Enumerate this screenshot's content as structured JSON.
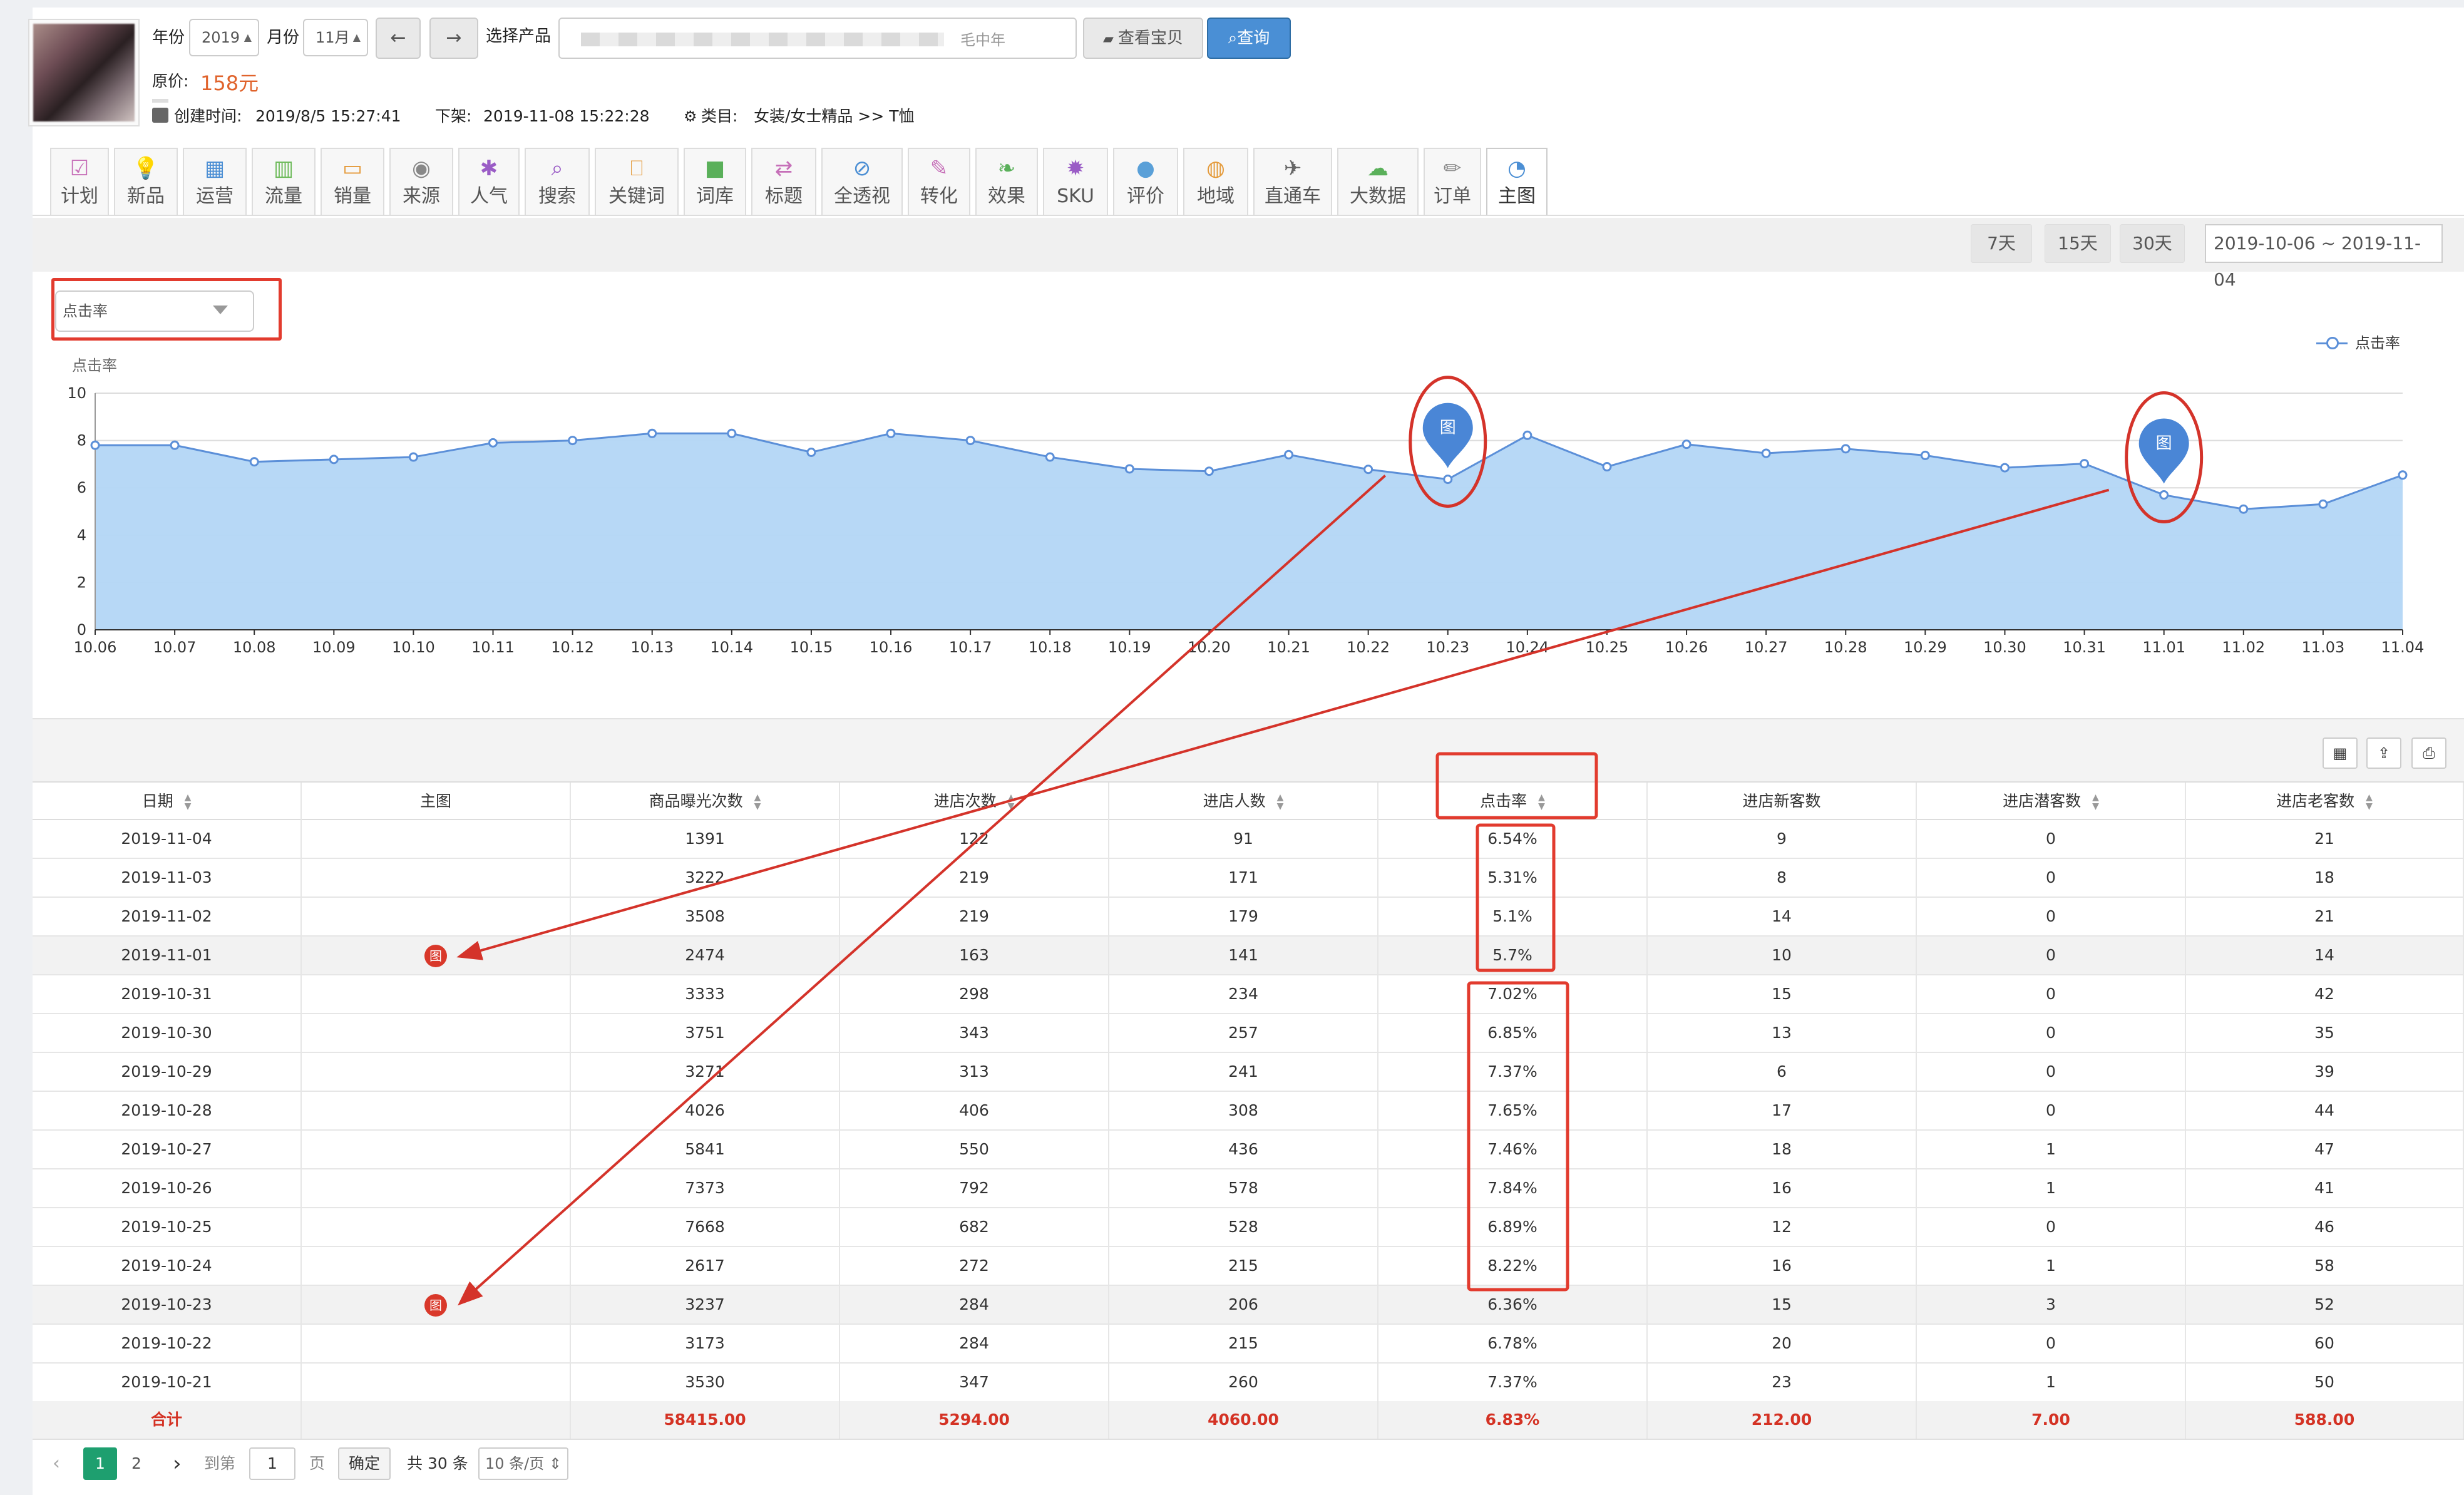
{
  "header": {
    "year_label": "年份",
    "year_value": "2019",
    "month_label": "月份",
    "month_value": "11月",
    "product_label": "选择产品",
    "product_value_fragment": "毛中年",
    "view_item_button": "查看宝贝",
    "query_button": "查询",
    "original_price_label": "原价:",
    "original_price_value": "158元",
    "created_label": "创建时间:",
    "created_value": "2019/8/5 15:27:41",
    "offshelf_label": "下架:",
    "offshelf_value": "2019-11-08 15:22:28",
    "category_label": "类目:",
    "category_value": "女装/女士精品 >> T恤"
  },
  "tabs": [
    {
      "label": "计划",
      "icon": "checkbox-icon",
      "color": "#c66fb8"
    },
    {
      "label": "新品",
      "icon": "lightbulb-icon",
      "color": "#5aa0d8"
    },
    {
      "label": "运营",
      "icon": "calendar-icon",
      "color": "#4c8fd4"
    },
    {
      "label": "流量",
      "icon": "barcode-icon",
      "color": "#6dba5a"
    },
    {
      "label": "销量",
      "icon": "credit-card-icon",
      "color": "#e49a3a"
    },
    {
      "label": "来源",
      "icon": "eye-icon",
      "color": "#888888"
    },
    {
      "label": "人气",
      "icon": "asterisk-icon",
      "color": "#9a5cc6"
    },
    {
      "label": "搜索",
      "icon": "search-icon",
      "color": "#9a5cc6"
    },
    {
      "label": "关键词",
      "icon": "inbox-icon",
      "color": "#e49a3a"
    },
    {
      "label": "词库",
      "icon": "briefcase-icon",
      "color": "#5ab05a"
    },
    {
      "label": "标题",
      "icon": "swap-icon",
      "color": "#c66fb8"
    },
    {
      "label": "全透视",
      "icon": "eye-slash-icon",
      "color": "#4c8fd4"
    },
    {
      "label": "转化",
      "icon": "wrench-icon",
      "color": "#c66fb8"
    },
    {
      "label": "效果",
      "icon": "leaf-icon",
      "color": "#5ab05a"
    },
    {
      "label": "SKU",
      "icon": "gear-icon",
      "color": "#9a5cc6"
    },
    {
      "label": "评价",
      "icon": "comments-icon",
      "color": "#5aa0d8"
    },
    {
      "label": "地域",
      "icon": "basketball-icon",
      "color": "#e49a3a"
    },
    {
      "label": "直通车",
      "icon": "plane-icon",
      "color": "#666666"
    },
    {
      "label": "大数据",
      "icon": "cloud-download-icon",
      "color": "#5ab05a"
    },
    {
      "label": "订单",
      "icon": "pencil-icon",
      "color": "#888888"
    },
    {
      "label": "主图",
      "icon": "dashboard-icon",
      "color": "#4c8fd4"
    }
  ],
  "range_buttons": [
    "7天",
    "15天",
    "30天"
  ],
  "date_range": "2019-10-06 ~ 2019-11-04",
  "metric_select": "点击率",
  "chart_data": {
    "type": "area",
    "ylabel": "点击率",
    "ylim": [
      0,
      10
    ],
    "yticks": [
      0,
      2,
      4,
      6,
      8,
      10
    ],
    "legend": "点击率",
    "legend_position": "top-right",
    "grid": true,
    "color": "#5b8fd8",
    "fill": "#b3d6f5",
    "categories": [
      "10.06",
      "10.07",
      "10.08",
      "10.09",
      "10.10",
      "10.11",
      "10.12",
      "10.13",
      "10.14",
      "10.15",
      "10.16",
      "10.17",
      "10.18",
      "10.19",
      "10.20",
      "10.21",
      "10.22",
      "10.23",
      "10.24",
      "10.25",
      "10.26",
      "10.27",
      "10.28",
      "10.29",
      "10.30",
      "10.31",
      "11.01",
      "11.02",
      "11.03",
      "11.04"
    ],
    "values": [
      7.8,
      7.8,
      7.1,
      7.2,
      7.3,
      7.9,
      8.0,
      8.3,
      8.3,
      7.5,
      8.3,
      8.0,
      7.3,
      6.8,
      6.7,
      7.4,
      6.78,
      6.36,
      8.22,
      6.89,
      7.84,
      7.46,
      7.65,
      7.37,
      6.85,
      7.02,
      5.7,
      5.1,
      5.31,
      6.54
    ],
    "markers": [
      {
        "x": "10.23",
        "label": "图"
      },
      {
        "x": "11.01",
        "label": "图"
      }
    ]
  },
  "table": {
    "columns": [
      "日期",
      "主图",
      "商品曝光次数",
      "进店次数",
      "进店人数",
      "点击率",
      "进店新客数",
      "进店潜客数",
      "进店老客数"
    ],
    "rows": [
      [
        "2019-11-04",
        "",
        "1391",
        "122",
        "91",
        "6.54%",
        "9",
        "0",
        "21"
      ],
      [
        "2019-11-03",
        "",
        "3222",
        "219",
        "171",
        "5.31%",
        "8",
        "0",
        "18"
      ],
      [
        "2019-11-02",
        "",
        "3508",
        "219",
        "179",
        "5.1%",
        "14",
        "0",
        "21"
      ],
      [
        "2019-11-01",
        "图",
        "2474",
        "163",
        "141",
        "5.7%",
        "10",
        "0",
        "14"
      ],
      [
        "2019-10-31",
        "",
        "3333",
        "298",
        "234",
        "7.02%",
        "15",
        "0",
        "42"
      ],
      [
        "2019-10-30",
        "",
        "3751",
        "343",
        "257",
        "6.85%",
        "13",
        "0",
        "35"
      ],
      [
        "2019-10-29",
        "",
        "3271",
        "313",
        "241",
        "7.37%",
        "6",
        "0",
        "39"
      ],
      [
        "2019-10-28",
        "",
        "4026",
        "406",
        "308",
        "7.65%",
        "17",
        "0",
        "44"
      ],
      [
        "2019-10-27",
        "",
        "5841",
        "550",
        "436",
        "7.46%",
        "18",
        "1",
        "47"
      ],
      [
        "2019-10-26",
        "",
        "7373",
        "792",
        "578",
        "7.84%",
        "16",
        "1",
        "41"
      ],
      [
        "2019-10-25",
        "",
        "7668",
        "682",
        "528",
        "6.89%",
        "12",
        "0",
        "46"
      ],
      [
        "2019-10-24",
        "",
        "2617",
        "272",
        "215",
        "8.22%",
        "16",
        "1",
        "58"
      ],
      [
        "2019-10-23",
        "图",
        "3237",
        "284",
        "206",
        "6.36%",
        "15",
        "3",
        "52"
      ],
      [
        "2019-10-22",
        "",
        "3173",
        "284",
        "215",
        "6.78%",
        "20",
        "0",
        "60"
      ],
      [
        "2019-10-21",
        "",
        "3530",
        "347",
        "260",
        "7.37%",
        "23",
        "1",
        "50"
      ]
    ],
    "total": [
      "合计",
      "",
      "58415.00",
      "5294.00",
      "4060.00",
      "6.83%",
      "212.00",
      "7.00",
      "588.00"
    ]
  },
  "pagination": {
    "pages": [
      "1",
      "2"
    ],
    "current": "1",
    "goto_label": "到第",
    "goto_value": "1",
    "page_unit": "页",
    "confirm": "确定",
    "total_text": "共 30 条",
    "page_size": "10 条/页"
  },
  "colors": {
    "accent": "#4a8fd5",
    "annotation": "#d4332a",
    "total_text": "#d43224",
    "pagination_active": "#1e9f6f"
  }
}
